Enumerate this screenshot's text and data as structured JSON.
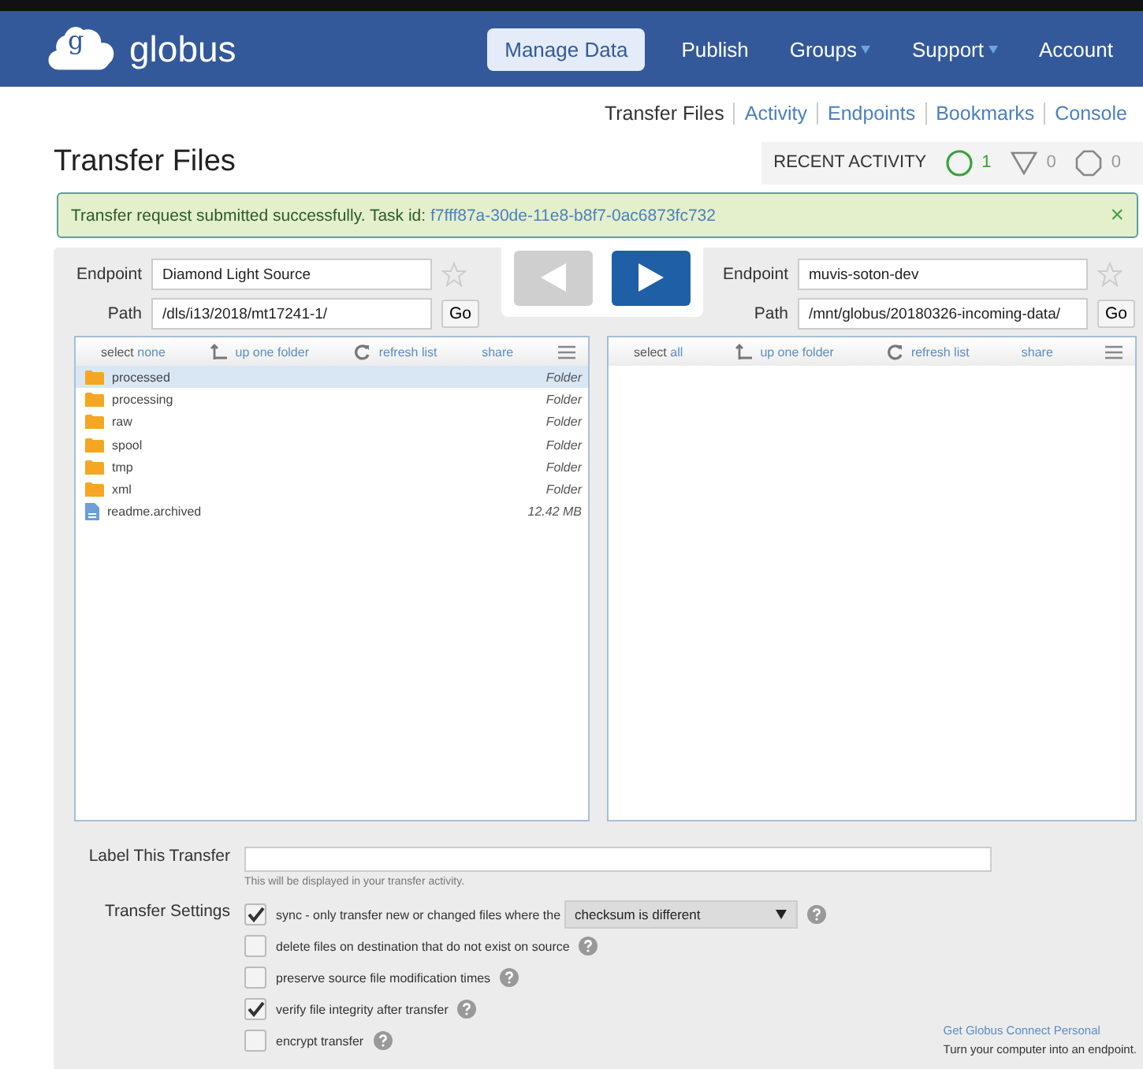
{
  "brand": {
    "name": "globus",
    "logo_letter": "g"
  },
  "nav": [
    {
      "label": "Manage Data",
      "selected": true,
      "dropdown": false
    },
    {
      "label": "Publish",
      "selected": false,
      "dropdown": false
    },
    {
      "label": "Groups",
      "selected": false,
      "dropdown": true
    },
    {
      "label": "Support",
      "selected": false,
      "dropdown": true
    },
    {
      "label": "Account",
      "selected": false,
      "dropdown": false
    }
  ],
  "subnav": [
    {
      "label": "Transfer Files",
      "selected": true
    },
    {
      "label": "Activity",
      "selected": false
    },
    {
      "label": "Endpoints",
      "selected": false
    },
    {
      "label": "Bookmarks",
      "selected": false
    },
    {
      "label": "Console",
      "selected": false
    }
  ],
  "page_title": "Transfer Files",
  "recent_activity": {
    "label": "RECENT ACTIVITY",
    "items": [
      {
        "kind": "active",
        "count": "1"
      },
      {
        "kind": "failed",
        "count": "0"
      },
      {
        "kind": "paused",
        "count": "0"
      }
    ]
  },
  "alert": {
    "text": "Transfer request submitted successfully. Task id:",
    "task_id": "f7fff87a-30de-11e8-b8f7-0ac6873fc732",
    "close": "×"
  },
  "panels": [
    {
      "endpoint_label": "Endpoint",
      "endpoint": "Diamond Light Source",
      "path_label": "Path",
      "path": "/dls/i13/2018/mt17241-1/",
      "go": "Go",
      "select_label": "select",
      "select_action": "none",
      "up": "up one folder",
      "refresh": "refresh list",
      "share": "share",
      "files": [
        {
          "kind": "folder",
          "name": "processed",
          "info": "Folder",
          "selected": true
        },
        {
          "kind": "folder",
          "name": "processing",
          "info": "Folder",
          "selected": false
        },
        {
          "kind": "folder",
          "name": "raw",
          "info": "Folder",
          "selected": false
        },
        {
          "kind": "folder",
          "name": "spool",
          "info": "Folder",
          "selected": false
        },
        {
          "kind": "folder",
          "name": "tmp",
          "info": "Folder",
          "selected": false
        },
        {
          "kind": "folder",
          "name": "xml",
          "info": "Folder",
          "selected": false
        },
        {
          "kind": "file",
          "name": "readme.archived",
          "info": "12.42 MB",
          "selected": false
        }
      ]
    },
    {
      "endpoint_label": "Endpoint",
      "endpoint": "muvis-soton-dev",
      "path_label": "Path",
      "path": "/mnt/globus/20180326-incoming-data/",
      "go": "Go",
      "select_label": "select",
      "select_action": "all",
      "up": "up one folder",
      "refresh": "refresh list",
      "share": "share"
    }
  ],
  "transfer_arrows": [
    {
      "kind": "left",
      "disabled": true
    },
    {
      "kind": "right",
      "disabled": false
    }
  ],
  "label_transfer": {
    "label": "Label This Transfer",
    "hint": "This will be displayed in your transfer activity."
  },
  "settings": {
    "label": "Transfer Settings",
    "options": [
      {
        "text": "sync - only transfer new or changed files where the",
        "checked": true,
        "select": "checksum is different"
      },
      {
        "text": "delete files on destination that do not exist on source",
        "checked": false
      },
      {
        "text": "preserve source file modification times",
        "checked": false
      },
      {
        "text": "verify file integrity after transfer",
        "checked": true
      },
      {
        "text": "encrypt transfer",
        "checked": false
      }
    ]
  },
  "promo": {
    "link": "Get Globus Connect Personal",
    "text": "Turn your computer into an endpoint."
  }
}
